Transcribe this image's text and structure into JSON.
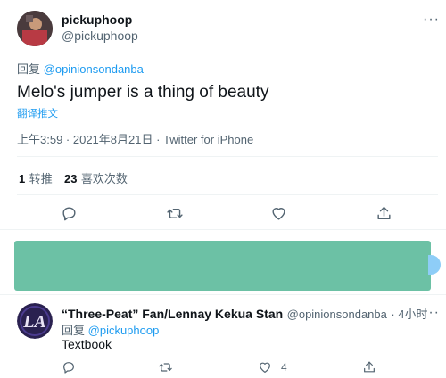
{
  "main_tweet": {
    "display_name": "pickuphoop",
    "handle": "@pickuphoop",
    "more_label": "···",
    "reply_prefix": "回复",
    "reply_to": "@opinionsondanba",
    "text": "Melo's jumper is a thing of beauty",
    "translate_label": "翻译推文",
    "timestamp": "上午3:59 · 2021年8月21日 · Twitter for iPhone",
    "retweet_count": "1",
    "retweet_label": "转推",
    "like_count": "23",
    "like_label": "喜欢次数"
  },
  "reply_tweet": {
    "display_name": "“Three-Peat” Fan/Lennay Kekua Stan",
    "handle": "@opinionsondanba",
    "time": "· 4小时",
    "more_label": "···",
    "reply_prefix": "回复",
    "reply_to": "@pickuphoop",
    "text": "Textbook",
    "like_count": "4"
  },
  "colors": {
    "accent": "#1d9bf0",
    "muted": "#536471",
    "redaction": "#6cc1a5"
  },
  "icons": [
    "comment-icon",
    "retweet-icon",
    "like-icon",
    "share-icon",
    "more-icon"
  ]
}
